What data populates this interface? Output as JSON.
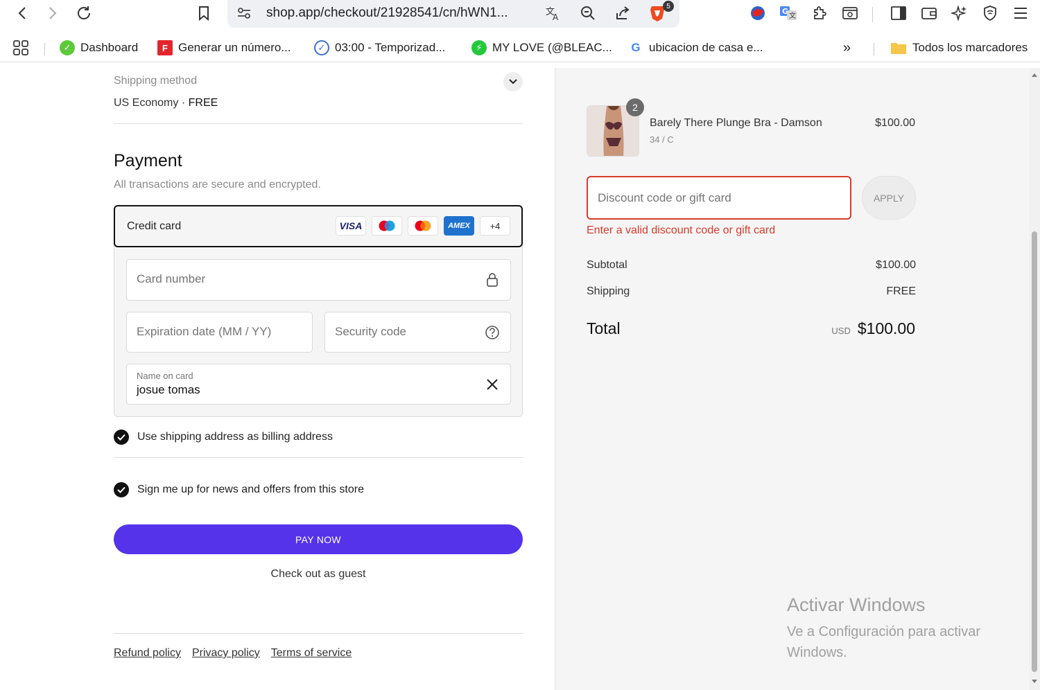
{
  "browser": {
    "url": "shop.app/checkout/21928541/cn/hWN1...",
    "brave_count": "5",
    "bookmarks": [
      {
        "label": "Dashboard"
      },
      {
        "label": "Generar un número..."
      },
      {
        "label": "03:00 - Temporizad..."
      },
      {
        "label": "MY LOVE (@BLEAC..."
      },
      {
        "label": "ubicacion de casa e..."
      }
    ],
    "all_bookmarks": "Todos los marcadores",
    "overflow": "»"
  },
  "shipping": {
    "label": "Shipping method",
    "method": "US Economy",
    "separator": "·",
    "price": "FREE"
  },
  "payment": {
    "title": "Payment",
    "subtitle": "All transactions are secure and encrypted.",
    "credit_card_label": "Credit card",
    "brands": [
      "VISA",
      "maestro",
      "mastercard",
      "AMEX",
      "+4"
    ],
    "card_number_placeholder": "Card number",
    "expiration_placeholder": "Expiration date (MM / YY)",
    "security_placeholder": "Security code",
    "name_label": "Name on card",
    "name_value": "josue tomas",
    "billing_checkbox": "Use shipping address as billing address",
    "billing_checked": true,
    "news_checkbox": "Sign me up for news and offers from this store",
    "news_checked": true,
    "pay_button": "PAY NOW",
    "guest_link": "Check out as guest"
  },
  "footer": {
    "refund": "Refund policy",
    "privacy": "Privacy policy",
    "terms": "Terms of service"
  },
  "summary": {
    "product_name": "Barely There Plunge Bra - Damson",
    "product_variant": "34 / C",
    "product_qty": "2",
    "product_price": "$100.00",
    "discount_placeholder": "Discount code or gift card",
    "apply": "APPLY",
    "discount_error": "Enter a valid discount code or gift card",
    "subtotal_label": "Subtotal",
    "subtotal_value": "$100.00",
    "shipping_label": "Shipping",
    "shipping_value": "FREE",
    "total_label": "Total",
    "currency": "USD",
    "total_value": "$100.00"
  },
  "watermark": {
    "line1": "Activar Windows",
    "line2": "Ve a Configuración para activar Windows."
  },
  "colors": {
    "pay_button": "#5433eb",
    "error": "#d83b2b",
    "summary_bg": "#f5f5f5"
  }
}
